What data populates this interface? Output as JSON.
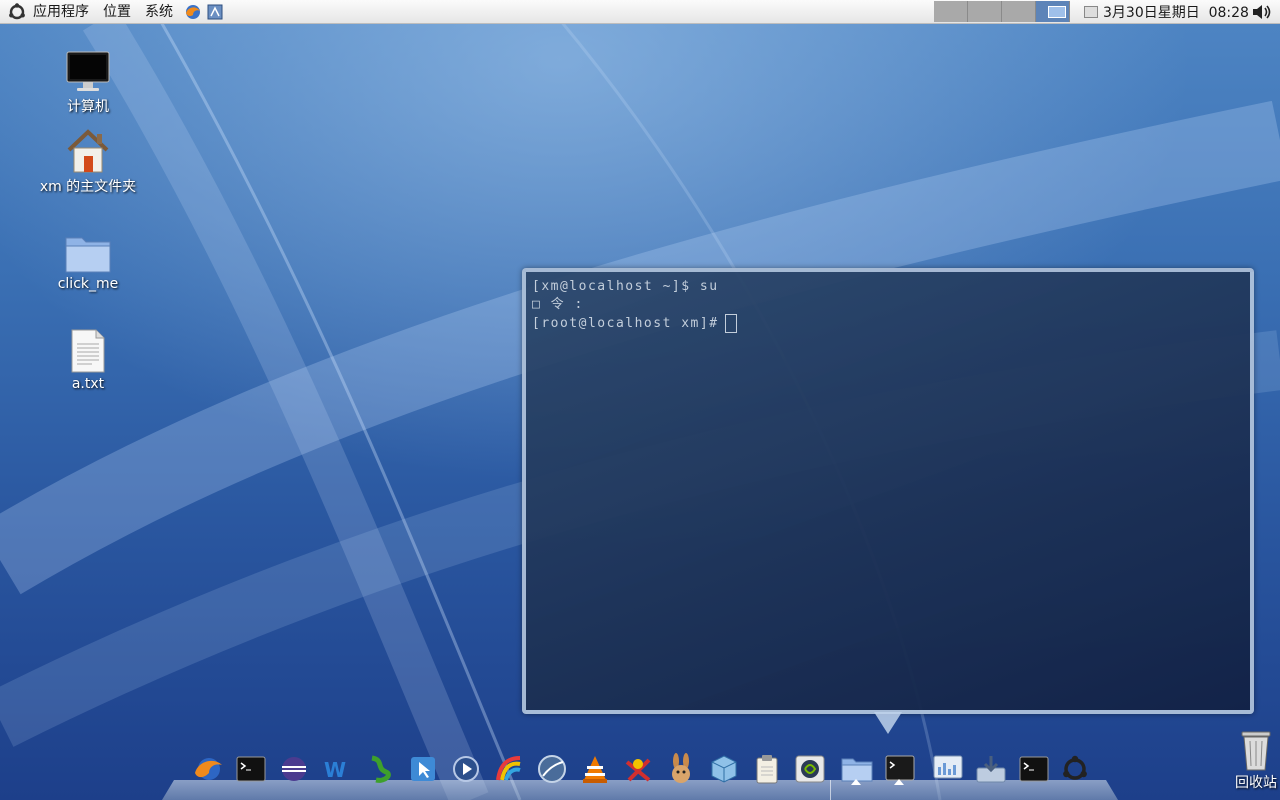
{
  "top_panel": {
    "menus": [
      "应用程序",
      "位置",
      "系统"
    ],
    "workspaces": [
      {
        "active": false
      },
      {
        "active": false
      },
      {
        "active": false
      },
      {
        "active": true
      }
    ],
    "clock": "3月30日星期日  08:28"
  },
  "desktop": {
    "icons": [
      {
        "label": "计算机",
        "icon": "computer-icon"
      },
      {
        "label": "xm 的主文件夹",
        "icon": "home-folder-icon"
      },
      {
        "label": "click_me",
        "icon": "folder-icon"
      },
      {
        "label": "a.txt",
        "icon": "text-file-icon"
      }
    ],
    "trash_label": "回收站"
  },
  "terminal": {
    "lines": [
      "[xm@localhost ~]$ su",
      "□ 令 :",
      "[root@localhost xm]#"
    ]
  },
  "dock": {
    "items": [
      "firefox-icon",
      "terminal-icon",
      "eclipse-icon",
      "wiki-icon",
      "fuzzy-icon",
      "cursor-app-icon",
      "media-player-icon",
      "paint-icon",
      "globe-icon",
      "vlc-icon",
      "game-icon",
      "rabbit-icon",
      "virtualbox-icon",
      "clipboard-icon",
      "nvidia-icon",
      "folder-icon",
      "terminal-window-icon",
      "cpu-monitor-icon",
      "download-icon",
      "terminal-icon",
      "ubuntu-icon"
    ],
    "colors": {
      "firefox": "#f08a1c",
      "vlc": "#f07a00",
      "eclipse": "#4b3b8f",
      "wiki": "#2b7fd6"
    }
  }
}
